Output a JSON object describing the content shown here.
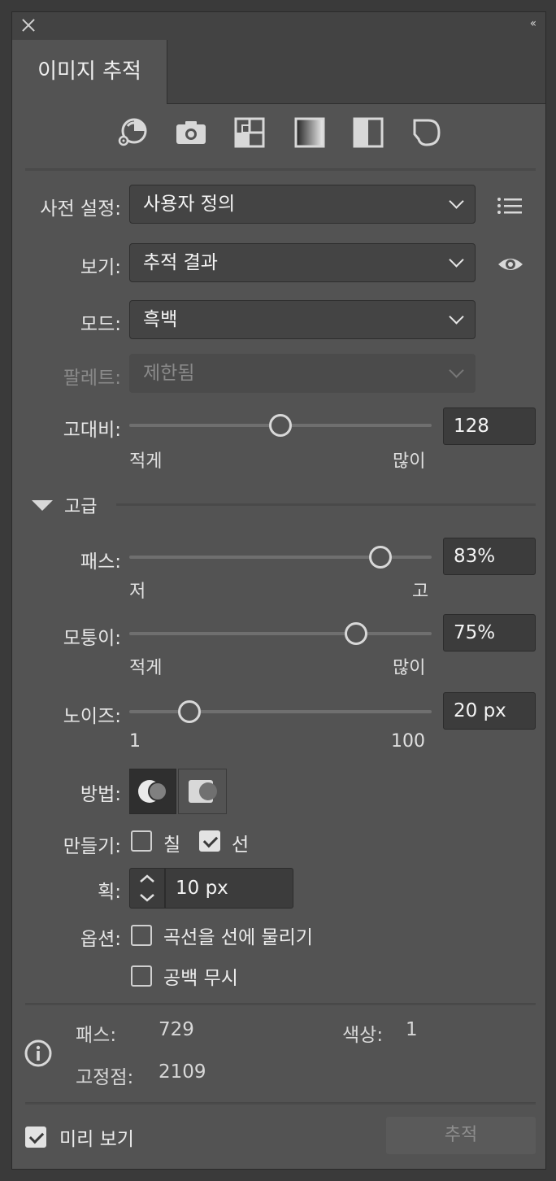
{
  "title": "이미지 추적",
  "icons": [
    "auto-color-icon",
    "high-color-icon",
    "low-color-icon",
    "grayscale-icon",
    "black-and-white-icon",
    "outline-icon"
  ],
  "preset": {
    "label": "사전 설정:",
    "value": "사용자 정의"
  },
  "view": {
    "label": "보기:",
    "value": "추적 결과"
  },
  "mode": {
    "label": "모드:",
    "value": "흑백"
  },
  "palette": {
    "label": "팔레트:",
    "value": "제한됨"
  },
  "threshold": {
    "label": "고대비:",
    "value": "128",
    "min_label": "적게",
    "max_label": "많이",
    "level": 0.5
  },
  "advanced": {
    "label": "고급"
  },
  "paths": {
    "label": "패스:",
    "value": "83%",
    "min_label": "저",
    "max_label": "고",
    "level": 0.83
  },
  "corners": {
    "label": "모퉁이:",
    "value": "75%",
    "min_label": "적게",
    "max_label": "많이",
    "level": 0.75
  },
  "noise": {
    "label": "노이즈:",
    "value": "20 px",
    "min_label": "1",
    "max_label": "100",
    "level": 0.2
  },
  "method": {
    "label": "방법:"
  },
  "create": {
    "label": "만들기:",
    "fill_label": "칠",
    "fill_checked": false,
    "stroke_label": "선",
    "stroke_checked": true
  },
  "stroke": {
    "label": "획:",
    "value": "10 px"
  },
  "options": {
    "label": "옵션:",
    "snap_curves": "곡선을 선에 물리기",
    "ignore_white": "공백 무시"
  },
  "stats": {
    "paths_label": "패스:",
    "paths_value": "729",
    "colors_label": "색상:",
    "colors_value": "1",
    "anchors_label": "고정점:",
    "anchors_value": "2109"
  },
  "footer": {
    "preview_label": "미리 보기",
    "preview_checked": true,
    "trace_button": "추적"
  }
}
